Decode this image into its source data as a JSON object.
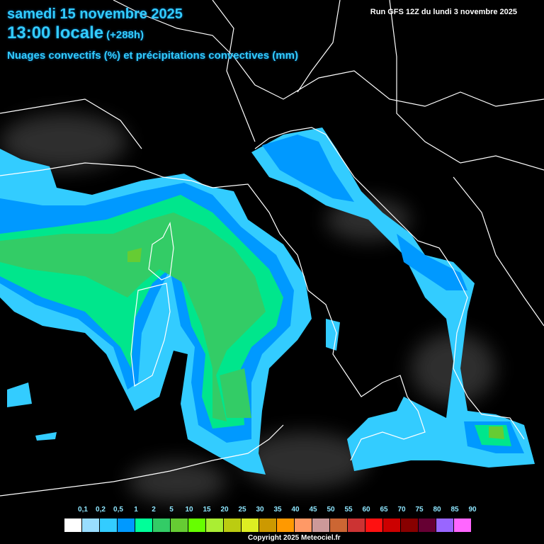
{
  "header": {
    "date": "samedi 15 novembre 2025",
    "local_time": "13:00 locale",
    "lead_time": "(+288h)",
    "parameter": "Nuages convectifs (%) et précipitations convectives (mm)",
    "run": "Run GFS 12Z du lundi 3 novembre 2025"
  },
  "legend": {
    "labels": [
      "0,1",
      "0,2",
      "0,5",
      "1",
      "2",
      "5",
      "10",
      "15",
      "20",
      "25",
      "30",
      "35",
      "40",
      "45",
      "50",
      "55",
      "60",
      "65",
      "70",
      "75",
      "80",
      "85",
      "90"
    ],
    "colors": [
      "#ffffff",
      "#99ddff",
      "#33ccff",
      "#0099ff",
      "#00ff99",
      "#33cc66",
      "#66cc33",
      "#66ff00",
      "#aaee33",
      "#bbcc11",
      "#ddee22",
      "#cc9900",
      "#ff9900",
      "#ff9966",
      "#cc9999",
      "#cc6633",
      "#cc3333",
      "#ff1111",
      "#cc0000",
      "#880000",
      "#660033",
      "#9966ff",
      "#ff66ff"
    ]
  },
  "footer": {
    "copyright": "Copyright 2025 Meteociel.fr"
  }
}
